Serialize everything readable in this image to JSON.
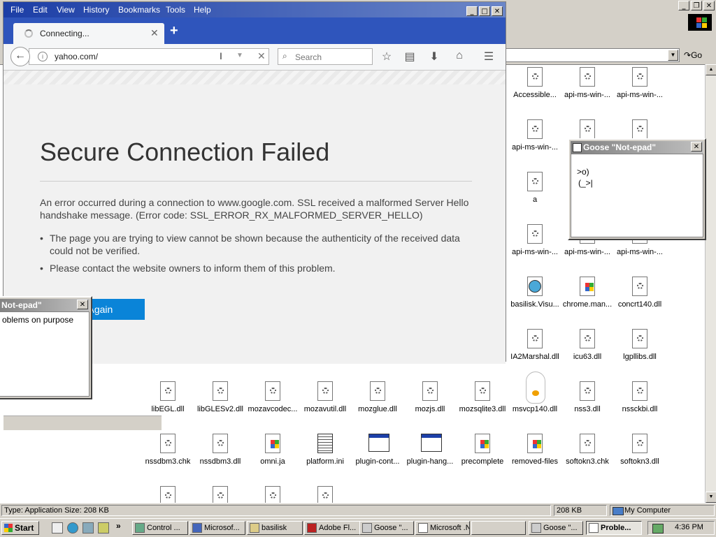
{
  "explorer": {
    "go_label": "Go",
    "files": [
      {
        "label": "Accessible...",
        "icon": "dll-icon"
      },
      {
        "label": "api-ms-win-...",
        "icon": "dll-icon"
      },
      {
        "label": "api-ms-win-...",
        "icon": "dll-icon"
      },
      {
        "label": "api-ms-win-...",
        "icon": "dll-icon"
      },
      {
        "label": "a",
        "icon": "dll-icon"
      },
      {
        "label": "api-ms-win-...",
        "icon": "dll-icon"
      },
      {
        "label": "a",
        "icon": "dll-icon"
      },
      {
        "label": "api-ms-win-...",
        "icon": "dll-icon"
      },
      {
        "label": "api-ms-win-...",
        "icon": "dll-icon"
      },
      {
        "label": "api-ms-win-...",
        "icon": "dll-icon"
      },
      {
        "label": "basilisk.Visu...",
        "icon": "manifest-icon"
      },
      {
        "label": "chrome.man...",
        "icon": "app-icon"
      },
      {
        "label": "concrt140.dll",
        "icon": "dll-icon"
      },
      {
        "label": "IA2Marshal.dll",
        "icon": "dll-icon"
      },
      {
        "label": "icu63.dll",
        "icon": "dll-icon"
      },
      {
        "label": "lgpllibs.dll",
        "icon": "dll-icon"
      },
      {
        "label": "libEGL.dll",
        "icon": "dll-icon"
      },
      {
        "label": "libGLESv2.dll",
        "icon": "dll-icon"
      },
      {
        "label": "mozavcodec...",
        "icon": "dll-icon"
      },
      {
        "label": "mozavutil.dll",
        "icon": "dll-icon"
      },
      {
        "label": "mozglue.dll",
        "icon": "dll-icon"
      },
      {
        "label": "mozjs.dll",
        "icon": "dll-icon"
      },
      {
        "label": "mozsqlite3.dll",
        "icon": "dll-icon"
      },
      {
        "label": "msvcp140.dll",
        "icon": "dll-icon"
      },
      {
        "label": "nss3.dll",
        "icon": "dll-icon"
      },
      {
        "label": "nssckbi.dll",
        "icon": "dll-icon"
      },
      {
        "label": "nssdbm3.chk",
        "icon": "dll-icon"
      },
      {
        "label": "nssdbm3.dll",
        "icon": "dll-icon"
      },
      {
        "label": "omni.ja",
        "icon": "app-icon"
      },
      {
        "label": "platform.ini",
        "icon": "ini-icon"
      },
      {
        "label": "plugin-cont...",
        "icon": "window-icon"
      },
      {
        "label": "plugin-hang...",
        "icon": "window-icon"
      },
      {
        "label": "precomplete",
        "icon": "app-icon"
      },
      {
        "label": "removed-files",
        "icon": "app-icon"
      },
      {
        "label": "softokn3.chk",
        "icon": "dll-icon"
      },
      {
        "label": "softokn3.dll",
        "icon": "dll-icon"
      }
    ],
    "status": {
      "type_size": "Type: Application Size: 208 KB",
      "size": "208 KB",
      "location": "My Computer"
    }
  },
  "firefox": {
    "menu": [
      "File",
      "Edit",
      "View",
      "History",
      "Bookmarks",
      "Tools",
      "Help"
    ],
    "tab_title": "Connecting...",
    "url": "yahoo.com/",
    "search_placeholder": "Search",
    "error": {
      "title": "Secure Connection Failed",
      "description": "An error occurred during a connection to www.google.com. SSL received a malformed Server Hello handshake message. (Error code: SSL_ERROR_RX_MALFORMED_SERVER_HELLO)",
      "bullets": [
        "The page you are trying to view cannot be shown because the authenticity of the received data could not be verified.",
        "Please contact the website owners to inform them of this problem."
      ],
      "button": "Try Again"
    }
  },
  "goose_notepad_1": {
    "title": "Goose \"Not-epad\"",
    "line1": ">o)",
    "line2": "(_>|"
  },
  "goose_notepad_2": {
    "title": "Not-epad\"",
    "text": "oblems on purpose"
  },
  "taskbar": {
    "start": "Start",
    "tasks": [
      "Control ...",
      "Microsof...",
      "basilisk",
      "Adobe Fl...",
      "Goose \"...",
      "Microsoft .N...",
      "",
      "Goose \"...",
      "Proble..."
    ],
    "clock": "4:36 PM"
  },
  "colors": {
    "titlebar": "#1c3ea6",
    "accent_button": "#0a84d8",
    "desktop_gray": "#d4d0c8"
  }
}
